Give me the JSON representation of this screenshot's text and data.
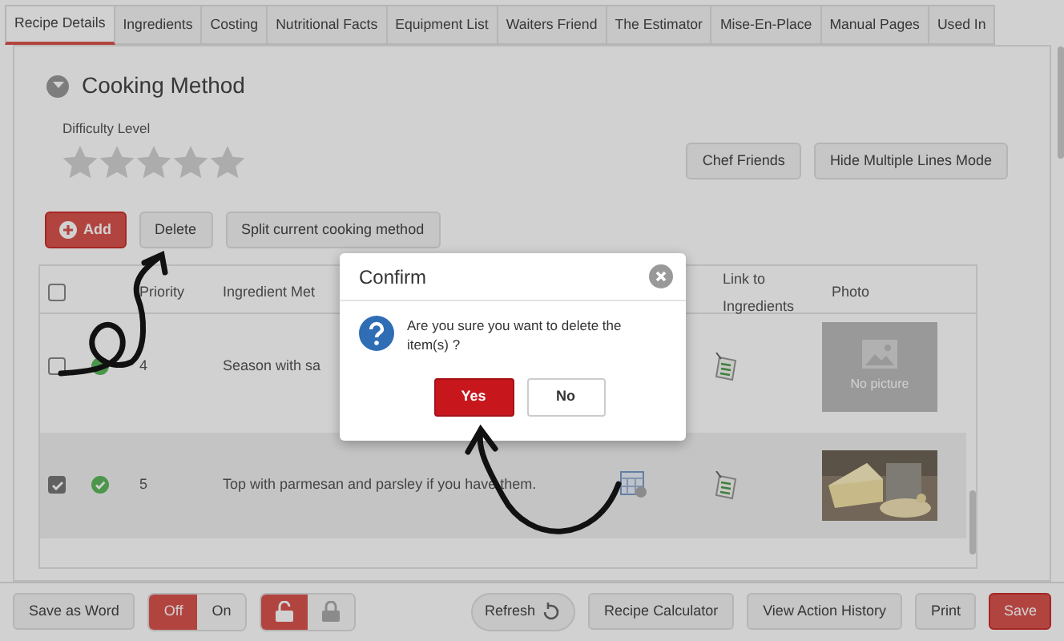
{
  "tabs": [
    {
      "label": "Recipe Details",
      "selected": true
    },
    {
      "label": "Ingredients",
      "selected": false
    },
    {
      "label": "Costing",
      "selected": false
    },
    {
      "label": "Nutritional Facts",
      "selected": false
    },
    {
      "label": "Equipment List",
      "selected": false
    },
    {
      "label": "Waiters Friend",
      "selected": false
    },
    {
      "label": "The Estimator",
      "selected": false
    },
    {
      "label": "Mise-En-Place",
      "selected": false
    },
    {
      "label": "Manual Pages",
      "selected": false
    },
    {
      "label": "Used In",
      "selected": false
    }
  ],
  "section": {
    "title": "Cooking Method",
    "expanded": true
  },
  "difficulty": {
    "label": "Difficulty Level",
    "stars": 0
  },
  "top_buttons": [
    "Chef Friends",
    "Hide Multiple Lines Mode"
  ],
  "toolbar": [
    {
      "label": "Add",
      "kind": "add"
    },
    {
      "label": "Delete",
      "kind": "plain"
    },
    {
      "label": "Split current cooking method",
      "kind": "plain"
    }
  ],
  "table": {
    "header_checked": false,
    "columns": [
      "Priority",
      "Ingredient Met",
      "Link to Ingredients",
      "Photo"
    ],
    "rows": [
      {
        "checked": false,
        "priority": "4",
        "method": "Season with sa",
        "schedule_icon": false,
        "photo": {
          "kind": "none",
          "caption": "No picture"
        }
      },
      {
        "checked": true,
        "priority": "5",
        "method": "Top with parmesan and parsley if you have them.",
        "schedule_icon": true
      }
    ]
  },
  "footer": {
    "save_word": "Save as Word",
    "toggle": [
      {
        "label": "Off",
        "selected": true
      },
      {
        "label": "On",
        "selected": false
      }
    ],
    "lock": [
      {
        "kind": "unlocked",
        "selected": true
      },
      {
        "kind": "locked",
        "selected": false
      }
    ],
    "buttons": [
      {
        "label": "Refresh",
        "kind": "refresh"
      },
      {
        "label": "Recipe Calculator",
        "kind": "plain"
      },
      {
        "label": "View Action History",
        "kind": "plain"
      },
      {
        "label": "Print",
        "kind": "plain"
      },
      {
        "label": "Save",
        "kind": "primary"
      }
    ]
  },
  "dialog": {
    "title": "Confirm",
    "message": "Are you sure you want to delete the item(s) ?",
    "buttons": [
      {
        "label": "Yes",
        "kind": "primary"
      },
      {
        "label": "No",
        "kind": "plain"
      }
    ]
  }
}
